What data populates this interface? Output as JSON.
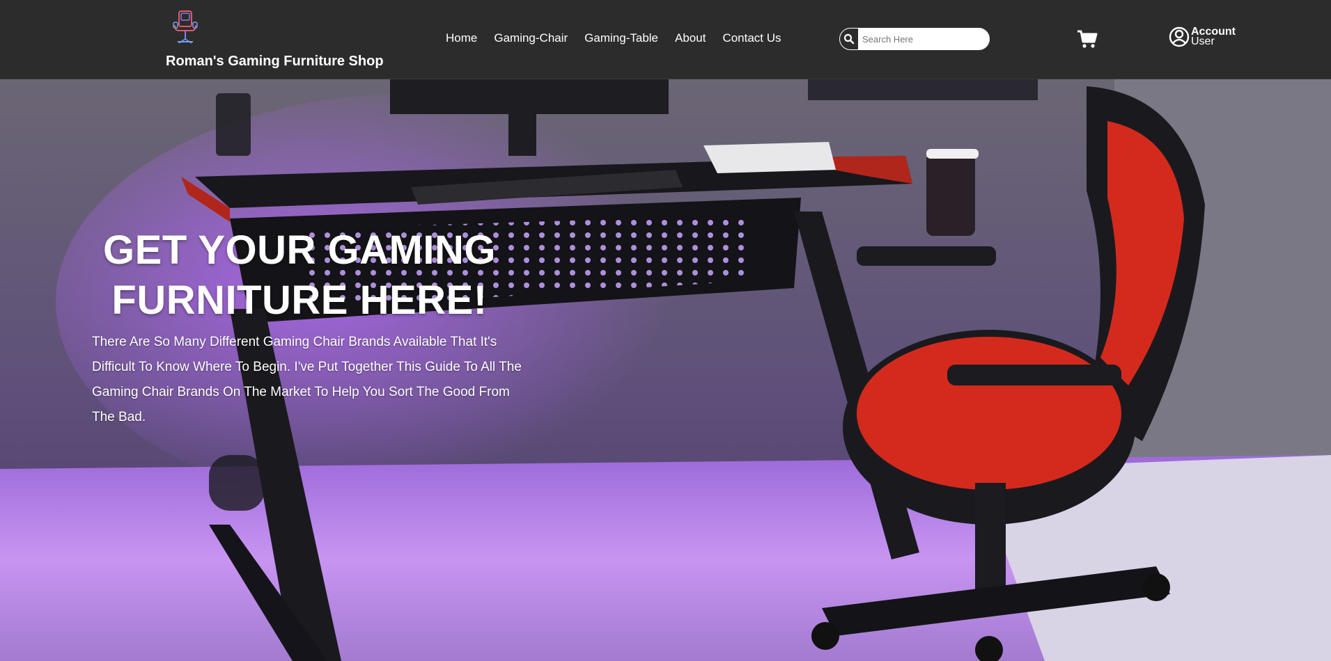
{
  "header": {
    "brand_name": "Roman's Gaming Furniture Shop",
    "logo_icon": "gaming-chair-logo-icon",
    "nav": [
      {
        "label": "Home"
      },
      {
        "label": "Gaming-Chair"
      },
      {
        "label": "Gaming-Table"
      },
      {
        "label": "About"
      },
      {
        "label": "Contact Us"
      }
    ],
    "search": {
      "placeholder": "Search Here",
      "icon": "search-icon"
    },
    "cart_icon": "cart-icon",
    "account": {
      "icon": "user-circle-icon",
      "line1": "Account",
      "line2": "User"
    }
  },
  "hero": {
    "headline_line1": "GET YOUR GAMING",
    "headline_line2": "FURNITURE HERE!",
    "description": "There Are So Many Different Gaming Chair Brands Available That It's Difficult To Know Where To Begin. I've Put Together This Guide To All The Gaming Chair Brands On The Market To Help You Sort The Good From The Bad."
  },
  "colors": {
    "navbar_bg": "#2c2c2c",
    "text": "#ffffff",
    "accent_purple": "#a57ad6",
    "chair_red": "#d42a1e"
  }
}
